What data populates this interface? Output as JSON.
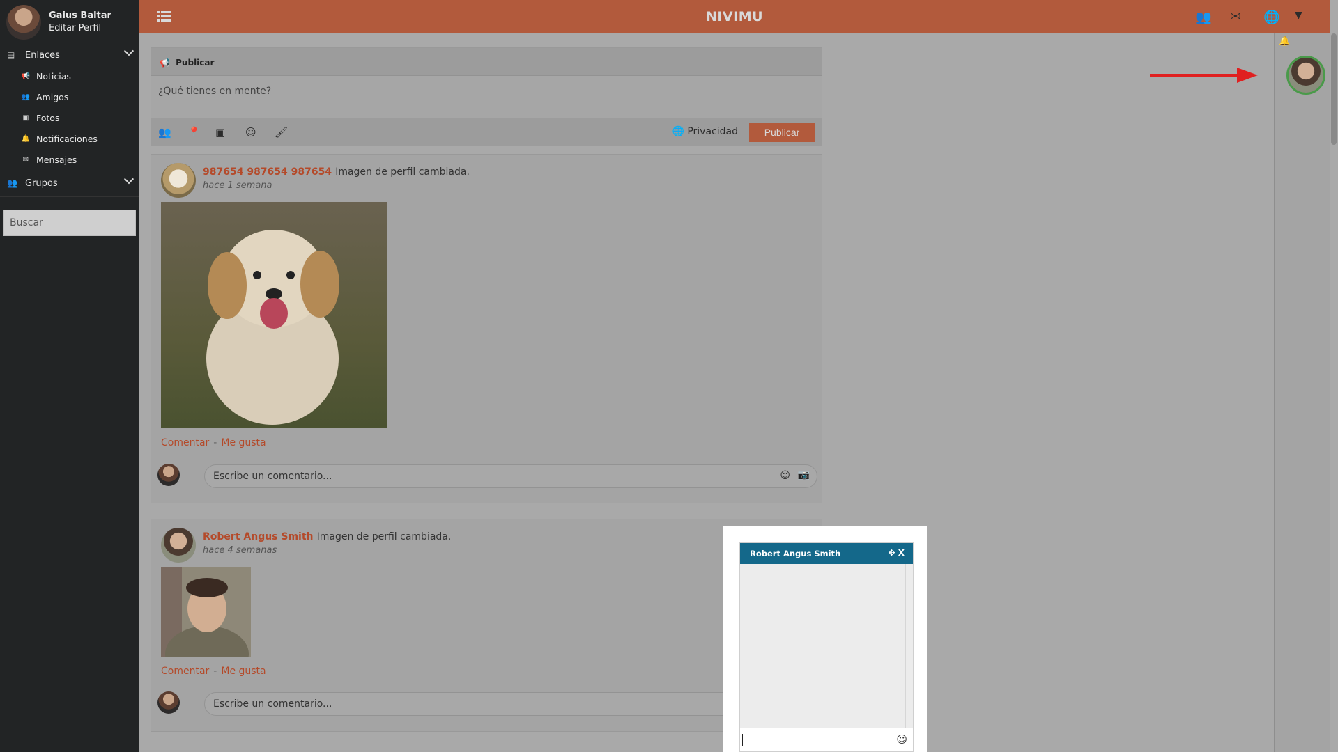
{
  "sidebar": {
    "user_name": "Gaius Baltar",
    "edit_profile": "Editar Perfil",
    "links_section": "Enlaces",
    "items": [
      {
        "label": "Noticias",
        "icon": "megaphone-icon"
      },
      {
        "label": "Amigos",
        "icon": "friends-icon"
      },
      {
        "label": "Fotos",
        "icon": "photo-icon"
      },
      {
        "label": "Notificaciones",
        "icon": "bell-icon"
      },
      {
        "label": "Mensajes",
        "icon": "mail-icon"
      }
    ],
    "groups_section": "Grupos",
    "search_placeholder": "Buscar"
  },
  "topbar": {
    "title": "NIVIMU",
    "icons": [
      "grid-icon",
      "friends-icon",
      "mail-icon",
      "globe-icon",
      "caret-down-icon"
    ]
  },
  "publish": {
    "header": "Publicar",
    "placeholder": "¿Qué tienes en mente?",
    "privacy": "Privacidad",
    "button": "Publicar",
    "tool_icons": [
      "tag-friends-icon",
      "location-icon",
      "image-icon",
      "emoji-icon",
      "brush-icon"
    ]
  },
  "posts": [
    {
      "author": "987654 987654 987654",
      "action": "Imagen de perfil cambiada.",
      "time": "hace 1 semana",
      "comment_link": "Comentar",
      "like_link": "Me gusta",
      "comment_placeholder": "Escribe un comentario..."
    },
    {
      "author": "Robert Angus Smith",
      "action": "Imagen de perfil cambiada.",
      "time": "hace 4 semanas",
      "comment_link": "Comentar",
      "like_link": "Me gusta",
      "comment_placeholder": "Escribe un comentario..."
    }
  ],
  "chat": {
    "title": "Robert Angus Smith",
    "close": "X"
  },
  "colors": {
    "brand": "#b25a3c",
    "chat_header": "#14688a",
    "sidebar_bg": "#222425",
    "online_ring": "#4a9a4a",
    "annotation_arrow": "#e02020"
  }
}
